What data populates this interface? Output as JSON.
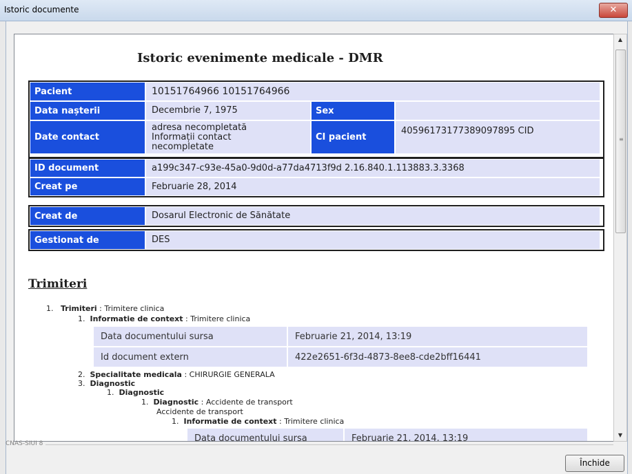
{
  "window": {
    "title": "Istoric documente",
    "close_glyph": "✕"
  },
  "document": {
    "title": "Istoric evenimente medicale - DMR",
    "patient": {
      "pacient_label": "Pacient",
      "pacient_value": "10151764966 10151764966",
      "birth_label": "Data nașterii",
      "birth_value": "Decembrie 7, 1975",
      "sex_label": "Sex",
      "sex_value": "",
      "contact_label": "Date contact",
      "contact_value_1": "adresa necompletată",
      "contact_value_2": "Informații contact",
      "contact_value_3": "necompletate",
      "ci_label": "CI pacient",
      "ci_value": "40596173177389097895 CID"
    },
    "doc_id": {
      "label": "ID document",
      "value": "a199c347-c93e-45a0-9d0d-a77da4713f9d 2.16.840.1.113883.3.3368"
    },
    "created_on": {
      "label": "Creat pe",
      "value": "Februarie 28, 2014"
    },
    "created_by": {
      "label": "Creat de",
      "value": "Dosarul Electronic de Sănătate"
    },
    "managed_by": {
      "label": "Gestionat de",
      "value": "DES"
    },
    "section_title": "Trimiteri",
    "tree": {
      "n1": "1.",
      "trimiteri_key": "Trimiteri",
      "trimiteri_val": " : Trimitere clinica",
      "n1_1": "1.",
      "context_key": "Informatie de context",
      "context_val": " : Trimitere clinica",
      "table1": {
        "r1_label": "Data documentului sursa",
        "r1_value": "Februarie 21, 2014, 13:19",
        "r2_label": "Id document extern",
        "r2_value": "422e2651-6f3d-4873-8ee8-cde2bff16441"
      },
      "n2": "2.",
      "spec_key": "Specialitate medicala",
      "spec_val": " : CHIRURGIE GENERALA",
      "n3": "3.",
      "diag_key": "Diagnostic",
      "n3_1": "1.",
      "diag_sub_key": "Diagnostic",
      "n3_1_1": "1.",
      "diag_item_key": "Diagnostic",
      "diag_item_val": " : Accidente de transport",
      "diag_item_text": "Accidente de transport",
      "n3_1_1_1": "1.",
      "ctx2_key": "Informatie de context",
      "ctx2_val": " : Trimitere clinica",
      "table2": {
        "r1_label": "Data documentului sursa",
        "r1_value": "Februarie 21, 2014, 13:19"
      }
    }
  },
  "status": {
    "text": "CNAS-SIUI 8"
  },
  "buttons": {
    "close_label": "Închide"
  }
}
